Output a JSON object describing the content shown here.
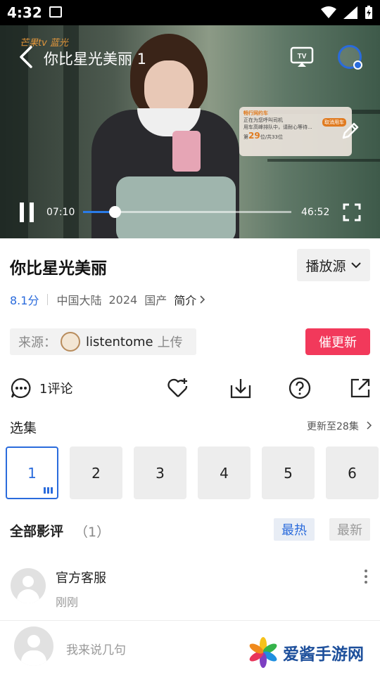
{
  "status_bar": {
    "time": "4:32"
  },
  "player": {
    "logo_text": "芒果tv 蓝光",
    "title": "你比星光美丽 1",
    "current_time": "07:10",
    "duration": "46:52",
    "progress": 0.153,
    "accent_color": "#2a7be8",
    "overlay_notification": {
      "brand": "畅行网约车",
      "line1": "正在为您呼叫司机",
      "line2": "用车高峰排队中，请耐心等待...",
      "rank_prefix": "第",
      "rank": "29",
      "rank_suffix": "位/共33位",
      "button": "取消用车"
    }
  },
  "show": {
    "title": "你比星光美丽",
    "source_button": "播放源",
    "score": "8.1分",
    "region": "中国大陆",
    "year": "2024",
    "type": "国产",
    "intro_link": "简介"
  },
  "uploader": {
    "label": "来源：",
    "name": "listentome",
    "suffix": "上传",
    "urge_button": "催更新",
    "urge_color": "#f2395b"
  },
  "actions": {
    "comment_label": "1评论",
    "icons": [
      "heart-plus-icon",
      "download-icon",
      "help-icon",
      "share-icon"
    ]
  },
  "episodes": {
    "heading": "选集",
    "update_info": "更新至28集",
    "items": [
      "1",
      "2",
      "3",
      "4",
      "5",
      "6"
    ],
    "selected": "1"
  },
  "reviews": {
    "heading": "全部影评",
    "count": "（1）",
    "sort_hot": "最热",
    "sort_new": "最新",
    "items": [
      {
        "name": "官方客服",
        "time": "刚刚"
      }
    ]
  },
  "composer": {
    "placeholder": "我来说几句"
  },
  "watermark": {
    "text": "爱酱手游网"
  }
}
